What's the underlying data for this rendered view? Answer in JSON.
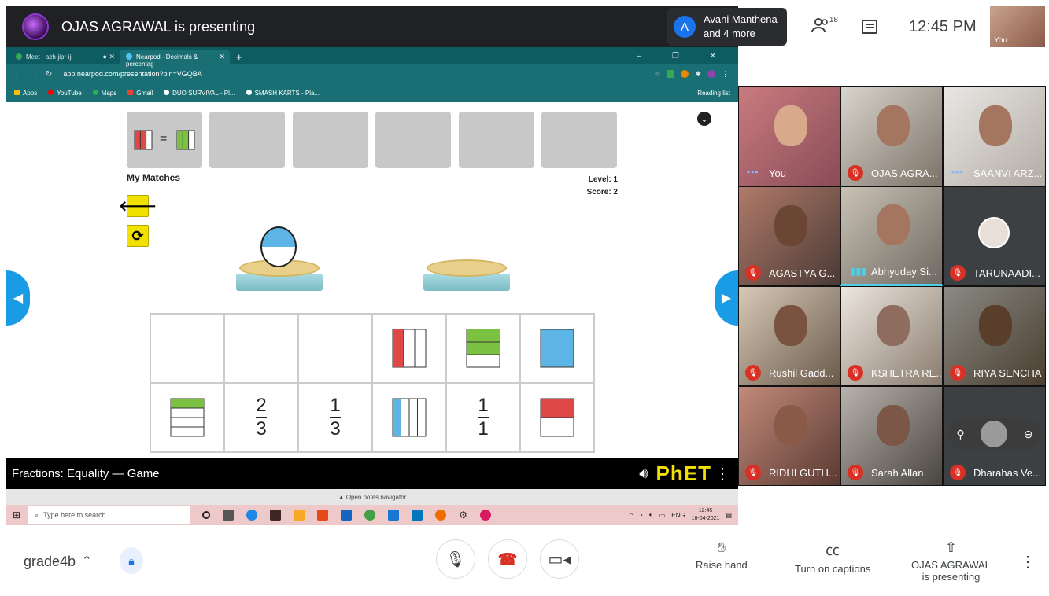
{
  "meet": {
    "presenter_banner": "OJAS AGRAWAL is presenting",
    "others_initial": "A",
    "others_name": "Avani Manthena",
    "others_more": "and 4 more",
    "people_count": "18",
    "clock": "12:45 PM",
    "self_label": "You",
    "meeting_code": "grade4b",
    "presenting_line1": "OJAS AGRAWAL",
    "presenting_line2": "is presenting",
    "raise_hand": "Raise hand",
    "captions": "Turn on captions"
  },
  "browser": {
    "tabs": [
      {
        "label": "Meet - azh-jipr-iji"
      },
      {
        "label": "Nearpod - Decimals & percentag"
      }
    ],
    "url": "app.nearpod.com/presentation?pin=VGQBA",
    "bookmarks": [
      "Apps",
      "YouTube",
      "Maps",
      "Gmail",
      "DUO SURVIVAL - Pl...",
      "SMASH KARTS - Pla..."
    ],
    "reading_list": "Reading list"
  },
  "game": {
    "my_matches": "My Matches",
    "level": "Level: 1",
    "score": "Score: 2",
    "equals": "=",
    "fractions": [
      {
        "num": "2",
        "den": "3"
      },
      {
        "num": "1",
        "den": "3"
      },
      {
        "num": "1",
        "den": "1"
      }
    ],
    "sim_title": "Fractions: Equality — Game",
    "phet": "PhET",
    "notes_nav": "▲ Open notes navigator"
  },
  "taskbar": {
    "search_placeholder": "Type here to search",
    "lang": "ENG",
    "time": "12:45",
    "date": "16-04-2021"
  },
  "participants": [
    {
      "name": "You"
    },
    {
      "name": "OJAS AGRA..."
    },
    {
      "name": "SAANVI ARZ..."
    },
    {
      "name": "AGASTYA G..."
    },
    {
      "name": "Abhyuday Si..."
    },
    {
      "name": "TARUNAADI..."
    },
    {
      "name": "Rushil Gadd..."
    },
    {
      "name": "KSHETRA RE..."
    },
    {
      "name": "RIYA SENCHA"
    },
    {
      "name": "RIDHI GUTH..."
    },
    {
      "name": "Sarah Allan"
    },
    {
      "name": "Dharahas Ve..."
    }
  ],
  "colors": {
    "meet_dark": "#202124",
    "browser_teal": "#1a6f74",
    "phet_yellow": "#f2e000",
    "fraction_blue": "#5cb5e5",
    "fraction_red": "#e04848",
    "fraction_green": "#7cc242",
    "mute_red": "#d93025"
  }
}
